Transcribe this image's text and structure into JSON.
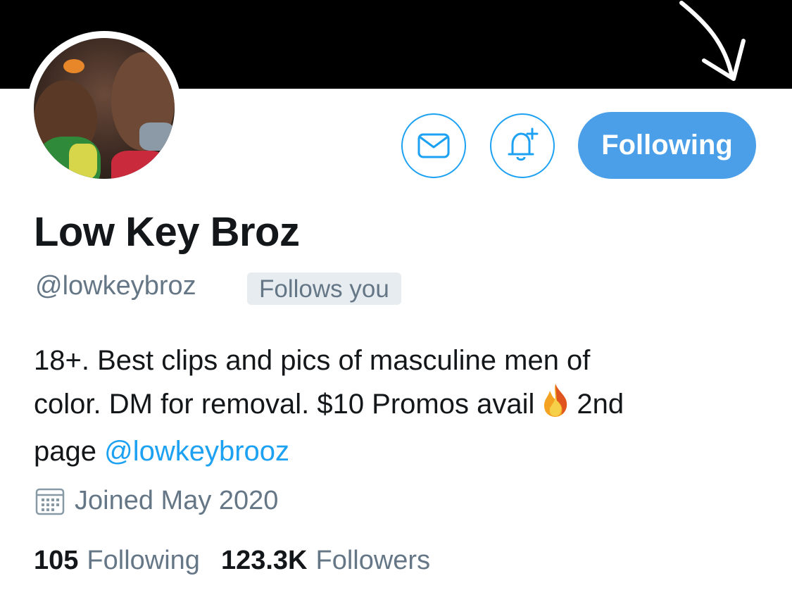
{
  "profile": {
    "display_name": "Low Key Broz",
    "handle": "@lowkeybroz",
    "follows_you_label": "Follows you",
    "bio": {
      "line1": "18+. Best clips and pics of masculine men of",
      "line2": "color. DM for removal. $10 Promos avail",
      "emoji": "fire-icon",
      "after_emoji": "2nd",
      "line3_prefix": "page",
      "mention": "@lowkeybrooz"
    },
    "joined": "Joined May 2020"
  },
  "actions": {
    "message_icon": "mail-icon",
    "notify_icon": "bell-plus-icon",
    "following_label": "Following"
  },
  "stats": {
    "following_count": "105",
    "following_label": "Following",
    "followers_count": "123.3K",
    "followers_label": "Followers"
  },
  "colors": {
    "accent": "#1da1f2",
    "button_fill": "#4a9fe8",
    "secondary_text": "#657786",
    "badge_bg": "#e6ecf0",
    "banner": "#000000"
  }
}
